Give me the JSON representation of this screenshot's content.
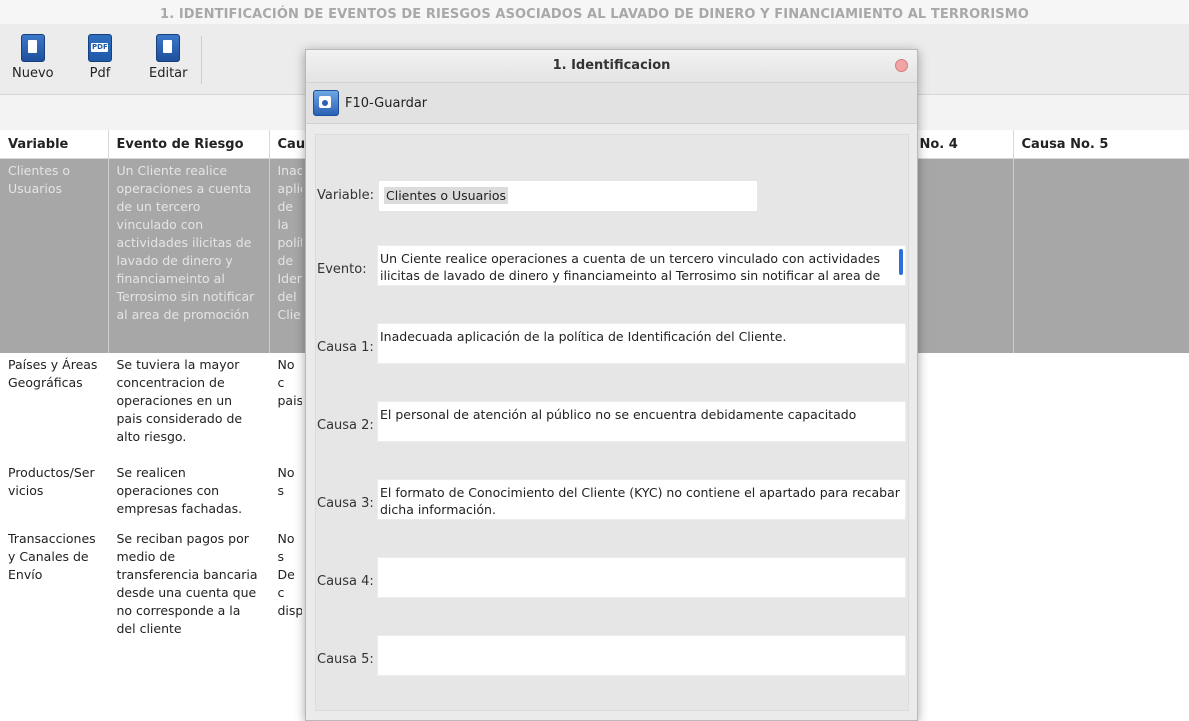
{
  "window": {
    "header_title": "1. IDENTIFICACIÓN DE EVENTOS DE RIESGOS ASOCIADOS AL LAVADO DE DINERO Y FINANCIAMIENTO AL TERRORISMO"
  },
  "toolbar": {
    "buttons": [
      {
        "label": "Nuevo",
        "icon": "new-document-icon"
      },
      {
        "label": "Pdf",
        "icon": "pdf-icon"
      },
      {
        "label": "Editar",
        "icon": "edit-icon"
      }
    ]
  },
  "table": {
    "columns": [
      "Variable",
      "Evento de Riesgo",
      "Cau",
      "No. 4",
      "Causa No. 5"
    ],
    "rows": [
      {
        "variable": "Clientes o Usuarios",
        "evento": "Un Cliente realice operaciones a cuenta de un tercero vinculado con actividades ilicitas de lavado de dinero y financiameinto al Terrosimo  sin notificar al area de promoción",
        "causa1": "Inadecuada aplicación de la política de Identificación del Cliente.",
        "selected": true
      },
      {
        "variable": "Países y Áreas Geográficas",
        "evento": "Se tuviera la mayor concentracion de operaciones en un pais considerado de alto riesgo.",
        "causa1": "No c paise",
        "selected": false
      },
      {
        "variable": "Productos/Servicios",
        "evento": "Se realicen operaciones con empresas fachadas.",
        "causa1": "No s",
        "selected": false
      },
      {
        "variable": "Transacciones y Canales de Envío",
        "evento": "Se reciban pagos por medio de transferencia bancaria desde una cuenta que no corresponde a la del cliente",
        "causa1": "No s De c disp",
        "selected": false
      }
    ]
  },
  "dialog": {
    "title": "1. Identificacion",
    "save_label": "F10-Guardar",
    "fields": {
      "variable": {
        "label": "Variable:",
        "value": "Clientes o Usuarios"
      },
      "evento": {
        "label": "Evento:",
        "value": "Un Ciente realice operaciones a cuenta de un tercero vinculado con actividades ilicitas de lavado de dinero y financiameinto al  Terrosimo  sin notificar al area de"
      },
      "causa1": {
        "label": "Causa 1:",
        "value": "Inadecuada aplicación de la política de Identificación del Cliente."
      },
      "causa2": {
        "label": "Causa 2:",
        "value": "El personal de atención al público no se encuentra debidamente capacitado"
      },
      "causa3": {
        "label": "Causa 3:",
        "value": "El formato de Conocimiento del Cliente (KYC) no contiene el apartado para recabar dicha información."
      },
      "causa4": {
        "label": "Causa 4:",
        "value": ""
      },
      "causa5": {
        "label": "Causa 5:",
        "value": ""
      }
    }
  }
}
